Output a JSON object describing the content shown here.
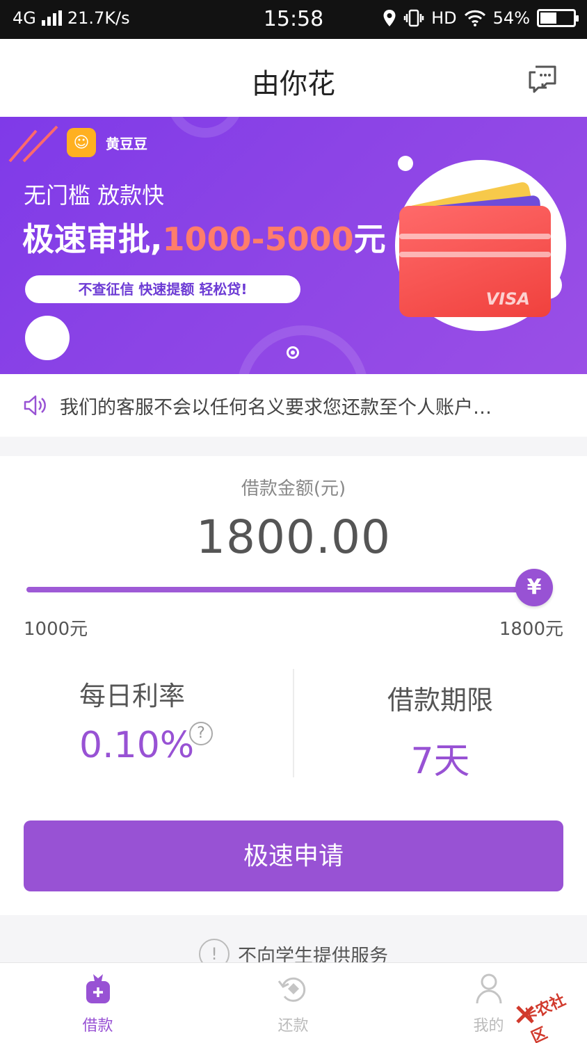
{
  "status_bar": {
    "network": "4G",
    "speed": "21.7K/s",
    "time": "15:58",
    "hd": "HD",
    "battery": "54%",
    "battery_level": 0.54
  },
  "header": {
    "title": "由你花",
    "message_icon": "chat-bubble-icon"
  },
  "banner": {
    "brand": "黄豆豆",
    "line1": "无门槛  放款快",
    "line2_prefix": "极速审批,",
    "line2_range": "1000-5000",
    "line2_suffix": "元",
    "pill": "不查征信  快速提额  轻松贷!",
    "card_brand": "VISA"
  },
  "notice": {
    "icon": "speaker-icon",
    "text": "我们的客服不会以任何名义要求您还款至个人账户…"
  },
  "loan": {
    "label": "借款金额(元)",
    "amount": "1800.00",
    "slider_min": 1000,
    "slider_max": 1800,
    "slider_value": 1800,
    "thumb_symbol": "¥",
    "min_label": "1000元",
    "max_label": "1800元",
    "rate_label": "每日利率",
    "rate_value": "0.10%",
    "help_symbol": "?",
    "term_label": "借款期限",
    "term_value": "7天",
    "apply_label": "极速申请"
  },
  "student_notice": {
    "icon_symbol": "!",
    "text": "不向学生提供服务"
  },
  "tabs": [
    {
      "label": "借款",
      "icon": "loan-bag-icon",
      "active": true
    },
    {
      "label": "还款",
      "icon": "repay-icon",
      "active": false
    },
    {
      "label": "我的",
      "icon": "user-icon",
      "active": false
    }
  ],
  "watermark": "卡农社区",
  "colors": {
    "accent": "#9852d4",
    "banner": "#8c44e6",
    "highlight": "#ff7d6b"
  }
}
